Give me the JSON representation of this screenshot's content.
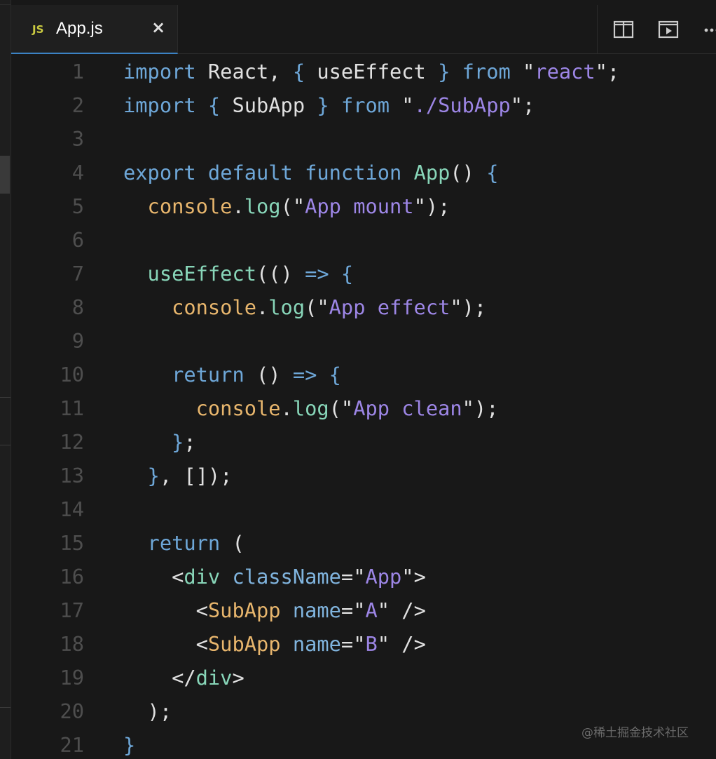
{
  "tab": {
    "icon": "JS",
    "label": "App.js",
    "close": "×"
  },
  "actions": [
    {
      "name": "split-editor-icon"
    },
    {
      "name": "open-preview-icon"
    },
    {
      "name": "more-actions-icon"
    }
  ],
  "editor": {
    "line_numbers": [
      "1",
      "2",
      "3",
      "4",
      "5",
      "6",
      "7",
      "8",
      "9",
      "10",
      "11",
      "12",
      "13",
      "14",
      "15",
      "16",
      "17",
      "18",
      "19",
      "20",
      "21"
    ],
    "lines": [
      [
        [
          "kw",
          "import"
        ],
        [
          "pl",
          " React, "
        ],
        [
          "br",
          "{"
        ],
        [
          "pl",
          " useEffect "
        ],
        [
          "br",
          "}"
        ],
        [
          "pl",
          " "
        ],
        [
          "kw",
          "from"
        ],
        [
          "pl",
          " \""
        ],
        [
          "str",
          "react"
        ],
        [
          "pl",
          "\";"
        ]
      ],
      [
        [
          "kw",
          "import"
        ],
        [
          "pl",
          " "
        ],
        [
          "br",
          "{"
        ],
        [
          "pl",
          " SubApp "
        ],
        [
          "br",
          "}"
        ],
        [
          "pl",
          " "
        ],
        [
          "kw",
          "from"
        ],
        [
          "pl",
          " \""
        ],
        [
          "str",
          "./SubApp"
        ],
        [
          "pl",
          "\";"
        ]
      ],
      [],
      [
        [
          "kw",
          "export"
        ],
        [
          "pl",
          " "
        ],
        [
          "kw",
          "default"
        ],
        [
          "pl",
          " "
        ],
        [
          "kw",
          "function"
        ],
        [
          "pl",
          " "
        ],
        [
          "fn",
          "App"
        ],
        [
          "pl",
          "() "
        ],
        [
          "br",
          "{"
        ]
      ],
      [
        [
          "pl",
          "  "
        ],
        [
          "obj",
          "console"
        ],
        [
          "pl",
          "."
        ],
        [
          "fn",
          "log"
        ],
        [
          "pl",
          "(\""
        ],
        [
          "str",
          "App mount"
        ],
        [
          "pl",
          "\");"
        ]
      ],
      [],
      [
        [
          "pl",
          "  "
        ],
        [
          "fn",
          "useEffect"
        ],
        [
          "pl",
          "(() "
        ],
        [
          "kw",
          "=>"
        ],
        [
          "pl",
          " "
        ],
        [
          "br",
          "{"
        ]
      ],
      [
        [
          "pl",
          "    "
        ],
        [
          "obj",
          "console"
        ],
        [
          "pl",
          "."
        ],
        [
          "fn",
          "log"
        ],
        [
          "pl",
          "(\""
        ],
        [
          "str",
          "App effect"
        ],
        [
          "pl",
          "\");"
        ]
      ],
      [],
      [
        [
          "pl",
          "    "
        ],
        [
          "kw",
          "return"
        ],
        [
          "pl",
          " () "
        ],
        [
          "kw",
          "=>"
        ],
        [
          "pl",
          " "
        ],
        [
          "br",
          "{"
        ]
      ],
      [
        [
          "pl",
          "      "
        ],
        [
          "obj",
          "console"
        ],
        [
          "pl",
          "."
        ],
        [
          "fn",
          "log"
        ],
        [
          "pl",
          "(\""
        ],
        [
          "str",
          "App clean"
        ],
        [
          "pl",
          "\");"
        ]
      ],
      [
        [
          "pl",
          "    "
        ],
        [
          "br",
          "}"
        ],
        [
          "pl",
          ";"
        ]
      ],
      [
        [
          "pl",
          "  "
        ],
        [
          "br",
          "}"
        ],
        [
          "pl",
          ", []);"
        ]
      ],
      [],
      [
        [
          "pl",
          "  "
        ],
        [
          "kw",
          "return"
        ],
        [
          "pl",
          " ("
        ]
      ],
      [
        [
          "pl",
          "    <"
        ],
        [
          "tag",
          "div"
        ],
        [
          "pl",
          " "
        ],
        [
          "attr",
          "className"
        ],
        [
          "pl",
          "=\""
        ],
        [
          "str",
          "App"
        ],
        [
          "pl",
          "\">"
        ]
      ],
      [
        [
          "pl",
          "      <"
        ],
        [
          "comp",
          "SubApp"
        ],
        [
          "pl",
          " "
        ],
        [
          "attr",
          "name"
        ],
        [
          "pl",
          "=\""
        ],
        [
          "str",
          "A"
        ],
        [
          "pl",
          "\" />"
        ]
      ],
      [
        [
          "pl",
          "      <"
        ],
        [
          "comp",
          "SubApp"
        ],
        [
          "pl",
          " "
        ],
        [
          "attr",
          "name"
        ],
        [
          "pl",
          "=\""
        ],
        [
          "str",
          "B"
        ],
        [
          "pl",
          "\" />"
        ]
      ],
      [
        [
          "pl",
          "    </"
        ],
        [
          "tag",
          "div"
        ],
        [
          "pl",
          ">"
        ]
      ],
      [
        [
          "pl",
          "  );"
        ]
      ],
      [
        [
          "br",
          "}"
        ]
      ]
    ]
  },
  "watermark": "@稀土掘金技术社区",
  "colors": {
    "accent": "#3b82c4",
    "keyword": "#6ea7d8",
    "string": "#9d86e6",
    "function": "#88d6b9",
    "object": "#e8b66d"
  }
}
